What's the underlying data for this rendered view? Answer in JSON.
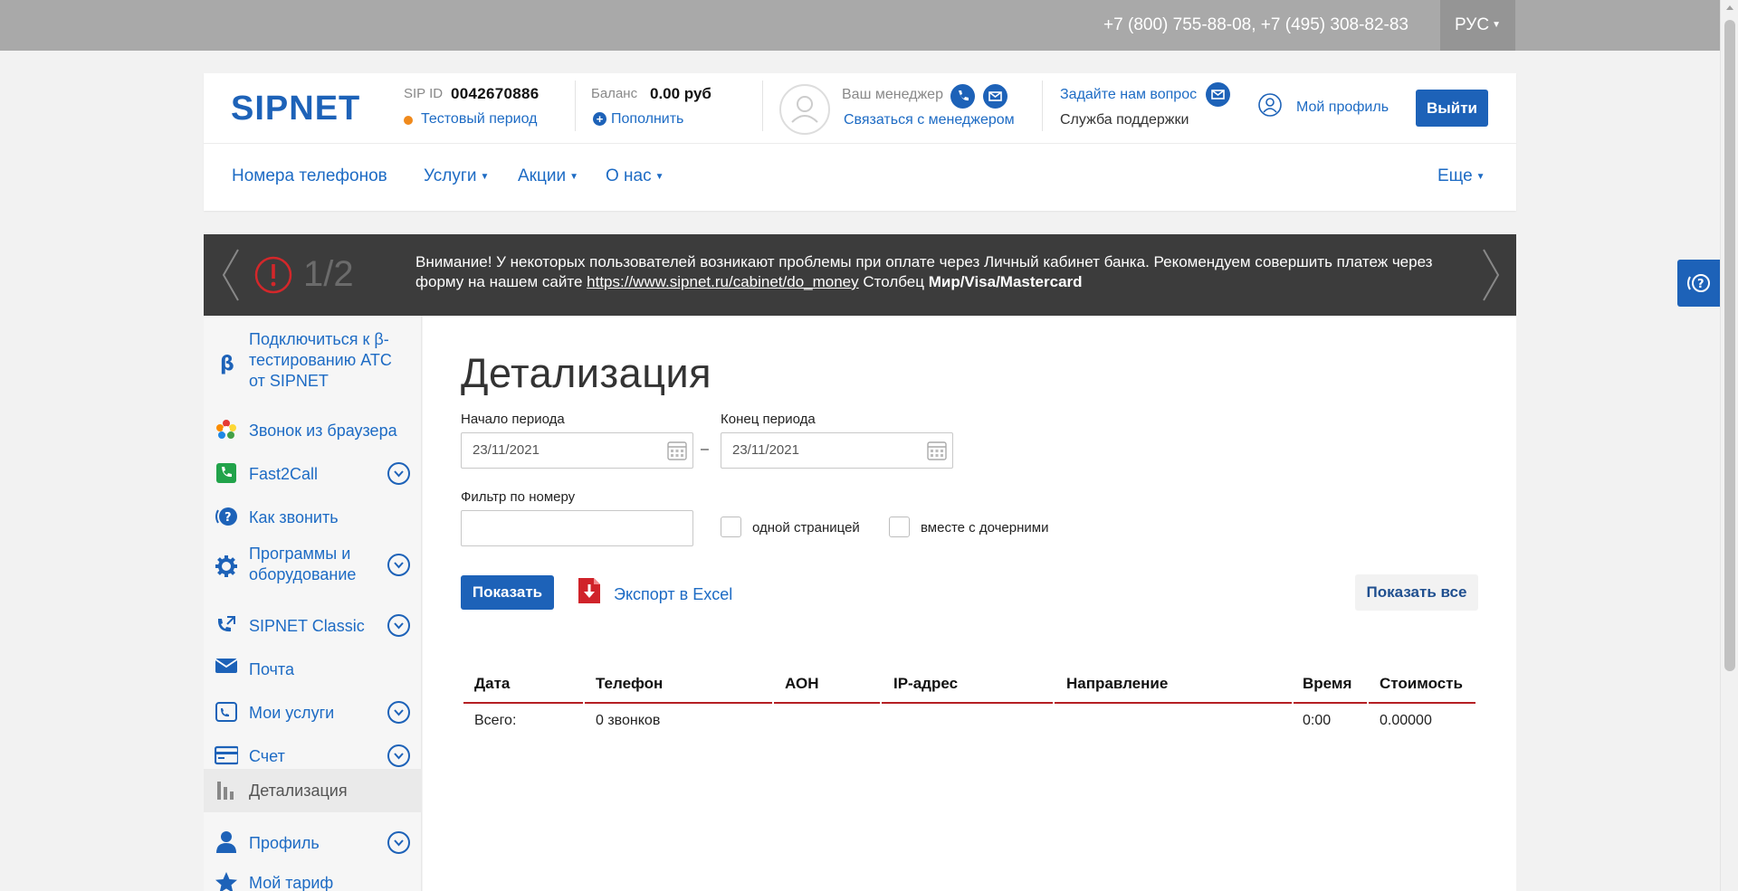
{
  "topbar": {
    "phones": "+7 (800) 755-88-08, +7 (495) 308-82-83",
    "language": "РУС"
  },
  "header": {
    "logo": "SIPNET",
    "sip_id_label": "SIP ID",
    "sip_id": "0042670886",
    "status": "Тестовый период",
    "balance_label": "Баланс",
    "balance": "0.00 руб",
    "topup": "Пополнить",
    "manager_label": "Ваш менеджер",
    "contact_manager": "Связаться с менеджером",
    "ask_question": "Задайте нам вопрос",
    "support": "Служба поддержки",
    "my_profile": "Мой профиль",
    "logout": "Выйти"
  },
  "nav": [
    {
      "label": "Номера телефонов"
    },
    {
      "label": "Услуги"
    },
    {
      "label": "Акции"
    },
    {
      "label": "О нас"
    },
    {
      "label": "Еще"
    }
  ],
  "notice": {
    "counter": "1/2",
    "text_before": "Внимание! У некоторых пользователей возникают проблемы при оплате через Личный кабинет банка. Рекомендуем совершить платеж через форму на нашем сайте ",
    "link": "https://www.sipnet.ru/cabinet/do_money",
    "text_after": " Столбец ",
    "bold": "Мир/Visa/Mastercard"
  },
  "sidebar": {
    "items": [
      {
        "label": "Подключиться к β-тестированию АТС от SIPNET"
      },
      {
        "label": "Звонок из браузера"
      },
      {
        "label": "Fast2Call"
      },
      {
        "label": "Как звонить"
      },
      {
        "label": "Программы и оборудование"
      },
      {
        "label": "SIPNET Classic"
      },
      {
        "label": "Почта"
      },
      {
        "label": "Мои услуги"
      },
      {
        "label": "Счет"
      },
      {
        "label": "Детализация"
      },
      {
        "label": "Профиль"
      },
      {
        "label": "Мой тариф"
      }
    ]
  },
  "main": {
    "title": "Детализация",
    "start_label": "Начало периода",
    "start_value": "23/11/2021",
    "end_label": "Конец периода",
    "end_value": "23/11/2021",
    "dash": "–",
    "filter_label": "Фильтр по номеру",
    "filter_value": "",
    "one_page": "одной страницей",
    "with_children": "вместе с дочерними",
    "show": "Показать",
    "export": "Экспорт в Excel",
    "show_all": "Показать все"
  },
  "table": {
    "headers": [
      "Дата",
      "Телефон",
      "АОН",
      "IP-адрес",
      "Направление",
      "Время",
      "Стоимость"
    ],
    "total_row": [
      "Всего:",
      "0 звонков",
      "",
      "",
      "",
      "0:00",
      "0.00000"
    ]
  },
  "colors": {
    "brand": "#1d62b8",
    "accent_red": "#b51f24",
    "topbar": "#a9a9a9",
    "notice_bg": "#3c3c3c"
  },
  "icons": [
    "beta-icon",
    "browser-call-icon",
    "phone-green-icon",
    "help-call-icon",
    "gear-icon",
    "phone-arrow-icon",
    "mail-icon",
    "services-icon",
    "card-icon",
    "bar-chart-icon",
    "person-icon",
    "star-icon"
  ]
}
